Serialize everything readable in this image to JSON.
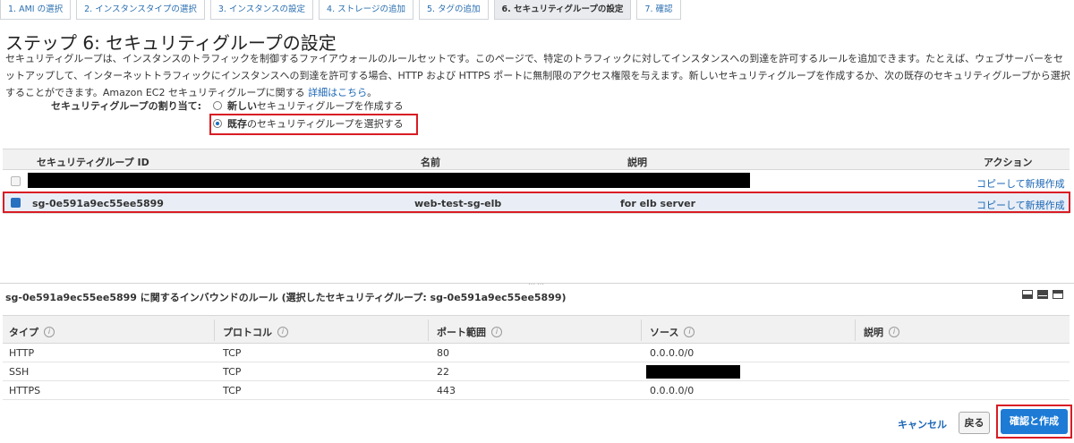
{
  "steps": [
    "1. AMI の選択",
    "2. インスタンスタイプの選択",
    "3. インスタンスの設定",
    "4. ストレージの追加",
    "5. タグの追加",
    "6. セキュリティグループの設定",
    "7. 確認"
  ],
  "page_title": "ステップ 6: セキュリティグループの設定",
  "description": {
    "text": "セキュリティグループは、インスタンスのトラフィックを制御するファイアウォールのルールセットです。このページで、特定のトラフィックに対してインスタンスへの到達を許可するルールを追加できます。たとえば、ウェブサーバーをセットアップして、インターネットトラフィックにインスタンスへの到達を許可する場合、HTTP および HTTPS ポートに無制限のアクセス権限を与えます。新しいセキュリティグループを作成するか、次の既存のセキュリティグループから選択することができます。Amazon EC2 セキュリティグループに関する ",
    "link": "詳細はこちら",
    "suffix": "。"
  },
  "assign": {
    "label": "セキュリティグループの割り当て:",
    "new_bold": "新しい",
    "new_rest": "セキュリティグループを作成する",
    "existing_bold": "既存",
    "existing_rest": "のセキュリティグループを選択する"
  },
  "sg_table": {
    "headers": {
      "id": "セキュリティグループ ID",
      "name": "名前",
      "desc": "説明",
      "action": "アクション"
    },
    "rows": [
      {
        "id": "",
        "name": "",
        "desc": "",
        "action": "コピーして新規作成"
      },
      {
        "id": "sg-0e591a9ec55ee5899",
        "name": "web-test-sg-elb",
        "desc": "for elb server",
        "action": "コピーして新規作成"
      }
    ]
  },
  "inbound_title": "sg-0e591a9ec55ee5899 に関するインバウンドのルール (選択したセキュリティグループ: sg-0e591a9ec55ee5899)",
  "rules": {
    "headers": {
      "type": "タイプ",
      "protocol": "プロトコル",
      "port": "ポート範囲",
      "source": "ソース",
      "desc": "説明"
    },
    "rows": [
      {
        "type": "HTTP",
        "protocol": "TCP",
        "port": "80",
        "source": "0.0.0.0/0"
      },
      {
        "type": "SSH",
        "protocol": "TCP",
        "port": "22",
        "source": ""
      },
      {
        "type": "HTTPS",
        "protocol": "TCP",
        "port": "443",
        "source": "0.0.0.0/0"
      }
    ]
  },
  "footer": {
    "cancel": "キャンセル",
    "back": "戻る",
    "confirm": "確認と作成"
  },
  "colors": {
    "link": "#1a66b5",
    "primary": "#1d7bd6",
    "highlight": "#d91c24"
  }
}
